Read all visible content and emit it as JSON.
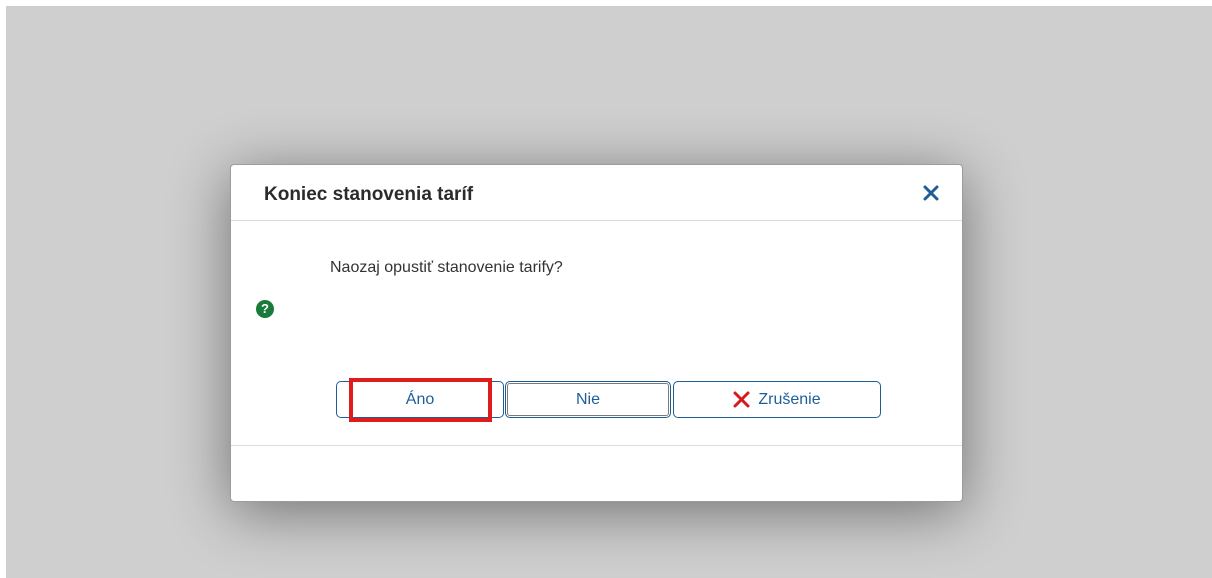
{
  "dialog": {
    "title": "Koniec stanovenia taríf",
    "close_icon": "close-icon",
    "message": "Naozaj opustiť stanovenie tarify?",
    "question_icon": "?",
    "buttons": {
      "yes_label": "Áno",
      "no_label": "Nie",
      "cancel_label": "Zrušenie",
      "cancel_icon": "x-icon"
    }
  },
  "colors": {
    "accent": "#1f5d99",
    "cancel_icon": "#d7191c",
    "highlight": "#e01b1b",
    "question_icon": "#1a7a3c",
    "backdrop": "#cfcfcf"
  }
}
